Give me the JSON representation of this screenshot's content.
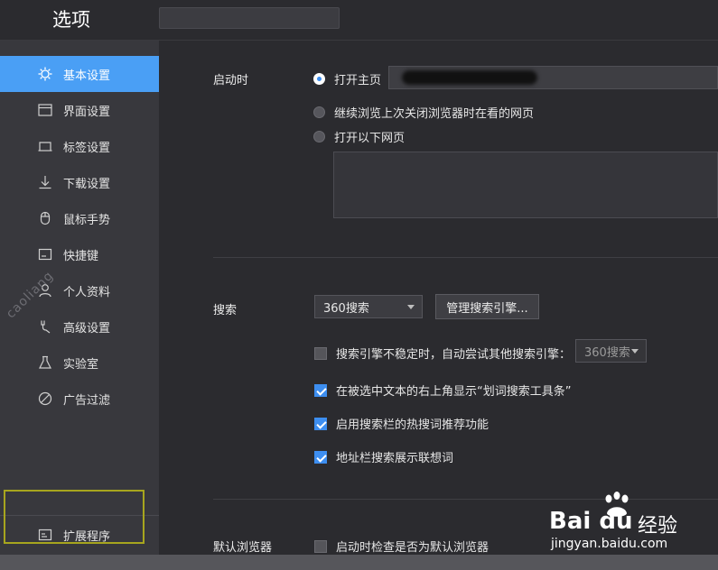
{
  "app": {
    "title": "选项"
  },
  "sidebar": {
    "items": [
      {
        "label": "基本设置",
        "icon": "gear-icon",
        "active": true
      },
      {
        "label": "界面设置",
        "icon": "window-icon",
        "active": false
      },
      {
        "label": "标签设置",
        "icon": "tab-icon",
        "active": false
      },
      {
        "label": "下载设置",
        "icon": "download-icon",
        "active": false
      },
      {
        "label": "鼠标手势",
        "icon": "mouse-icon",
        "active": false
      },
      {
        "label": "快捷键",
        "icon": "keyboard-icon",
        "active": false
      },
      {
        "label": "个人资料",
        "icon": "user-icon",
        "active": false
      },
      {
        "label": "高级设置",
        "icon": "wrench-icon",
        "active": false
      },
      {
        "label": "实验室",
        "icon": "flask-icon",
        "active": false
      },
      {
        "label": "广告过滤",
        "icon": "block-icon",
        "active": false
      }
    ],
    "extensions": {
      "label": "扩展程序",
      "icon": "extension-icon"
    }
  },
  "startup": {
    "label": "启动时",
    "options": [
      {
        "label": "打开主页",
        "checked": true
      },
      {
        "label": "继续浏览上次关闭浏览器时在看的网页",
        "checked": false
      },
      {
        "label": "打开以下网页",
        "checked": false
      }
    ]
  },
  "search": {
    "label": "搜索",
    "engine": "360搜索",
    "manage_button": "管理搜索引擎...",
    "checkboxes": [
      {
        "label": "搜索引擎不稳定时，自动尝试其他搜索引擎：",
        "checked": false,
        "fallback_engine": "360搜索"
      },
      {
        "label": "在被选中文本的右上角显示“划词搜索工具条”",
        "checked": true
      },
      {
        "label": "启用搜索栏的热搜词推荐功能",
        "checked": true
      },
      {
        "label": "地址栏搜索展示联想词",
        "checked": true
      }
    ]
  },
  "default_browser": {
    "label": "默认浏览器",
    "check_label": "启动时检查是否为默认浏览器",
    "checked": false
  },
  "watermarks": {
    "left_text": "caoliang",
    "baidu_logo": "Bai du",
    "baidu_jy": "经验",
    "baidu_url": "jingyan.baidu.com"
  },
  "colors": {
    "accent": "#4a9ff5",
    "highlight_border": "#a7a51e"
  }
}
